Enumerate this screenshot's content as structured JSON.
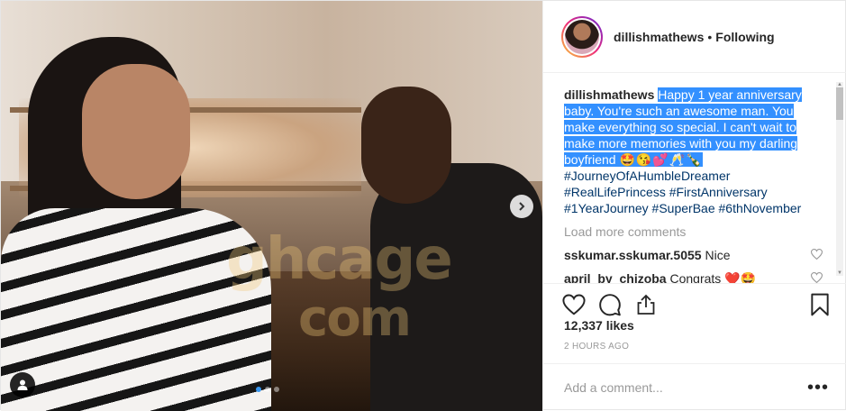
{
  "post": {
    "username": "dillishmathews",
    "separator": "•",
    "follow_status": "Following",
    "caption": {
      "username": "dillishmathews",
      "highlighted_text": "Happy 1 year anniversary baby. You're such an awesome man. You make everything so special. I can't wait to make more memories with you my darling boyfriend",
      "emoji": "🤩😘💕🥂🍾",
      "hashtags_line1": "#JourneyOfAHumbleDreamer",
      "hashtags_line2": "#RealLifePrincess #FirstAnniversary",
      "hashtags_line3": "#1YearJourney #SuperBae #6thNovember"
    },
    "load_more_label": "Load more comments",
    "comments": [
      {
        "username": "sskumar.sskumar.5055",
        "text": "Nice"
      },
      {
        "username": "april_by_chizoba",
        "text": "Congrats ❤️🤩"
      }
    ],
    "likes": "12,337 likes",
    "timestamp": "2 HOURS AGO",
    "add_comment_placeholder": "Add a comment...",
    "more_label": "•••"
  },
  "photo": {
    "watermark_line1": "ghcage",
    "watermark_line2": "com",
    "carousel_count": 3,
    "carousel_active": 0
  },
  "icons": {
    "like": "heart-icon",
    "comment": "comment-icon",
    "share": "share-icon",
    "save": "bookmark-icon",
    "next": "chevron-right-icon",
    "tag": "user-tag-icon"
  },
  "colors": {
    "selection": "#3390ff",
    "hashtag": "#003569",
    "muted": "#999999",
    "story_ring": [
      "#f9ce34",
      "#ee2a7b",
      "#6228d7"
    ]
  }
}
